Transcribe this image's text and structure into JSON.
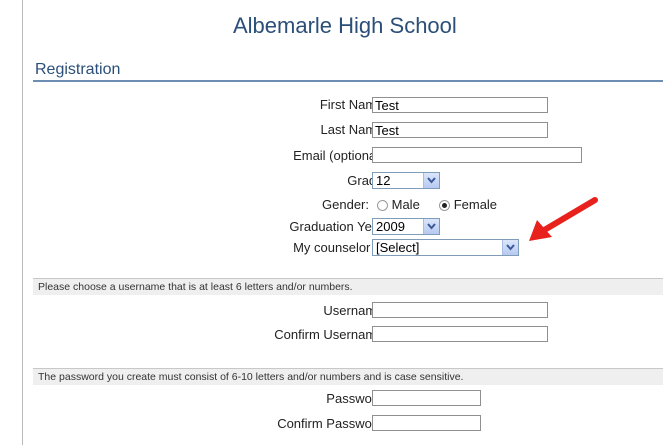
{
  "header": {
    "school_name": "Albemarle High School",
    "section_title": "Registration"
  },
  "form": {
    "first_name": {
      "label": "First Name:",
      "value": "Test"
    },
    "last_name": {
      "label": "Last Name:",
      "value": "Test"
    },
    "email": {
      "label": "Email (optional):",
      "value": ""
    },
    "grade": {
      "label": "Grade:",
      "value": "12"
    },
    "gender": {
      "label": "Gender:",
      "options": [
        "Male",
        "Female"
      ],
      "selected": "Female"
    },
    "graduation_year": {
      "label": "Graduation Year:",
      "value": "2009"
    },
    "counselor": {
      "label": "My counselor is:",
      "value": "[Select]"
    }
  },
  "username_section": {
    "instruction": "Please choose a username that is at least 6 letters and/or numbers.",
    "username_label": "Username:",
    "confirm_username_label": "Confirm Username:"
  },
  "password_section": {
    "instruction": "The password you create must consist of 6-10 letters and/or numbers and is case sensitive.",
    "password_label": "Password:",
    "confirm_password_label": "Confirm Password:"
  },
  "colors": {
    "heading": "#2b4f79",
    "arrow": "#e8211c",
    "band": "#efefef"
  }
}
